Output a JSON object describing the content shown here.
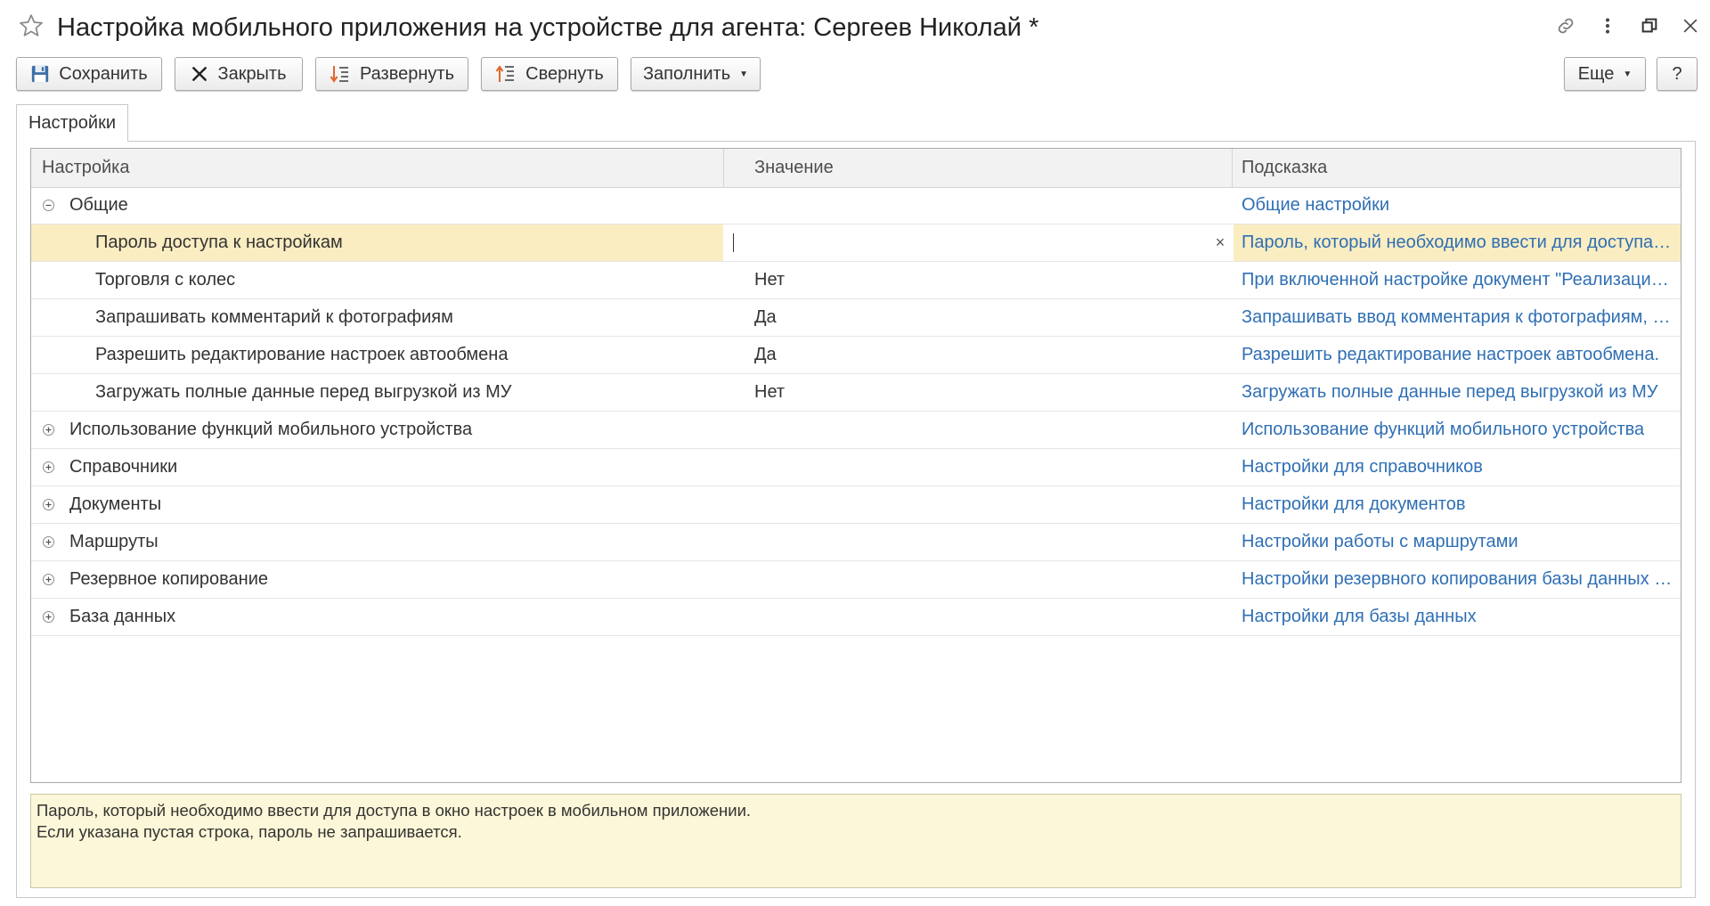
{
  "window": {
    "title": "Настройка мобильного приложения на устройстве для агента: Сергеев Николай *"
  },
  "toolbar": {
    "save": "Сохранить",
    "close": "Закрыть",
    "expand": "Развернуть",
    "collapse": "Свернуть",
    "fill": "Заполнить",
    "more": "Еще",
    "help": "?"
  },
  "tab": {
    "label": "Настройки"
  },
  "grid": {
    "columns": [
      "Настройка",
      "Значение",
      "Подсказка"
    ],
    "rows": [
      {
        "name": "Общие",
        "value": "",
        "hint": "Общие настройки",
        "level": 0,
        "toggle": "collapse"
      },
      {
        "name": "Пароль доступа к настройкам",
        "value": "",
        "hint": "Пароль, который необходимо ввести для доступа в окно настроек в мобильном приложении.",
        "level": 1,
        "selected": true
      },
      {
        "name": "Торговля с колес",
        "value": "Нет",
        "hint": "При включенной настройке документ \"Реализация\" формируется без заказа",
        "level": 1
      },
      {
        "name": "Запрашивать комментарий к фотографиям",
        "value": "Да",
        "hint": "Запрашивать ввод комментария к фотографиям, сделанным агентом",
        "level": 1
      },
      {
        "name": "Разрешить редактирование настроек автообмена",
        "value": "Да",
        "hint": "Разрешить редактирование настроек автообмена.",
        "level": 1
      },
      {
        "name": "Загружать полные данные перед выгрузкой из МУ",
        "value": "Нет",
        "hint": "Загружать полные данные перед выгрузкой из МУ",
        "level": 1
      },
      {
        "name": "Использование функций мобильного устройства",
        "value": "",
        "hint": "Использование функций мобильного устройства",
        "level": 0,
        "toggle": "expand"
      },
      {
        "name": "Справочники",
        "value": "",
        "hint": "Настройки для справочников",
        "level": 0,
        "toggle": "expand"
      },
      {
        "name": "Документы",
        "value": "",
        "hint": "Настройки для документов",
        "level": 0,
        "toggle": "expand"
      },
      {
        "name": "Маршруты",
        "value": "",
        "hint": "Настройки работы с маршрутами",
        "level": 0,
        "toggle": "expand"
      },
      {
        "name": "Резервное копирование",
        "value": "",
        "hint": "Настройки резервного копирования базы данных мобильного устройства",
        "level": 0,
        "toggle": "expand"
      },
      {
        "name": "База данных",
        "value": "",
        "hint": "Настройки для базы данных",
        "level": 0,
        "toggle": "expand"
      }
    ]
  },
  "description": {
    "line1": "Пароль, который необходимо ввести для доступа в окно настроек в мобильном приложении.",
    "line2": "Если указана пустая строка, пароль не запрашивается."
  },
  "colors": {
    "accent_link": "#2f6fb4",
    "selected_row": "#faedc1",
    "description_bg": "#fcf7d8"
  }
}
